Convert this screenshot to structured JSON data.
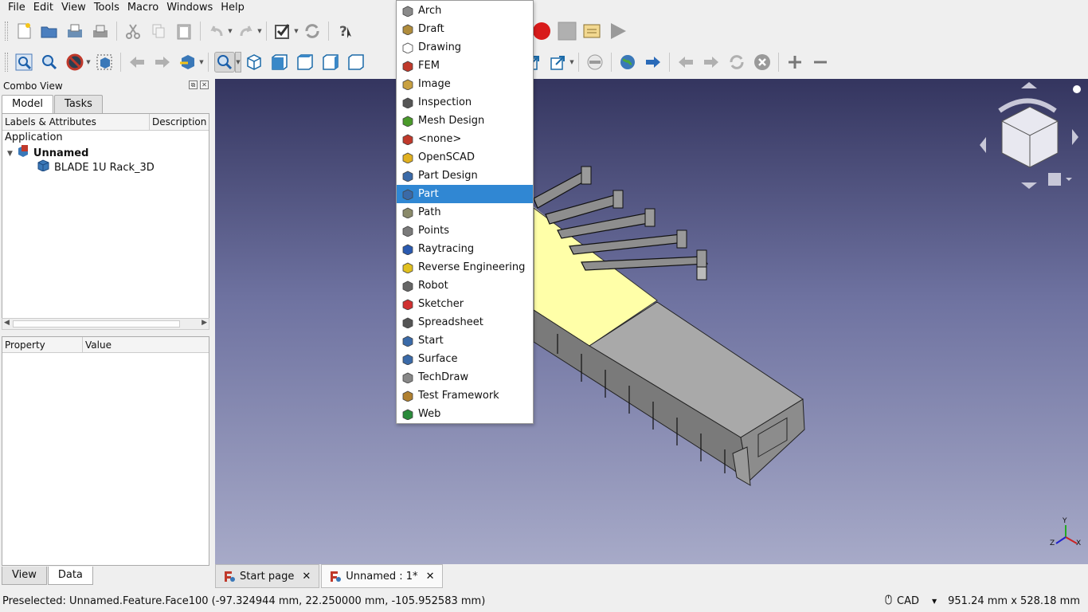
{
  "menubar": [
    "File",
    "Edit",
    "View",
    "Tools",
    "Macro",
    "Windows",
    "Help"
  ],
  "combo": {
    "title": "Combo View",
    "tabs": [
      "Model",
      "Tasks"
    ],
    "tree_headers": [
      "Labels & Attributes",
      "Description"
    ],
    "tree": {
      "root": "Application",
      "doc": "Unnamed",
      "child": "BLADE 1U Rack_3D"
    },
    "prop_headers": [
      "Property",
      "Value"
    ],
    "bottom_tabs": [
      "View",
      "Data"
    ]
  },
  "workbench_menu": {
    "selected": "Part",
    "items": [
      {
        "label": "Arch",
        "icon": "arch-icon",
        "color": "#8a8a8a"
      },
      {
        "label": "Draft",
        "icon": "draft-icon",
        "color": "#b08c3c"
      },
      {
        "label": "Drawing",
        "icon": "drawing-icon",
        "color": "#ffffff"
      },
      {
        "label": "FEM",
        "icon": "fem-icon",
        "color": "#c0392b"
      },
      {
        "label": "Image",
        "icon": "image-icon",
        "color": "#c8a040"
      },
      {
        "label": "Inspection",
        "icon": "inspection-icon",
        "color": "#555555"
      },
      {
        "label": "Mesh Design",
        "icon": "mesh-design-icon",
        "color": "#4a9a2a"
      },
      {
        "label": "<none>",
        "icon": "freecad-icon",
        "color": "#c0392b"
      },
      {
        "label": "OpenSCAD",
        "icon": "openscad-icon",
        "color": "#e0b020"
      },
      {
        "label": "Part Design",
        "icon": "part-design-icon",
        "color": "#3a6aa8"
      },
      {
        "label": "Part",
        "icon": "part-icon",
        "color": "#3a6aa8"
      },
      {
        "label": "Path",
        "icon": "path-icon",
        "color": "#8a8a6a"
      },
      {
        "label": "Points",
        "icon": "points-icon",
        "color": "#7a7a7a"
      },
      {
        "label": "Raytracing",
        "icon": "raytracing-icon",
        "color": "#2a5ab0"
      },
      {
        "label": "Reverse Engineering",
        "icon": "reverse-engineering-icon",
        "color": "#e0c020"
      },
      {
        "label": "Robot",
        "icon": "robot-icon",
        "color": "#666666"
      },
      {
        "label": "Sketcher",
        "icon": "sketcher-icon",
        "color": "#d03030"
      },
      {
        "label": "Spreadsheet",
        "icon": "spreadsheet-icon",
        "color": "#555555"
      },
      {
        "label": "Start",
        "icon": "start-icon",
        "color": "#3a6aa8"
      },
      {
        "label": "Surface",
        "icon": "surface-icon",
        "color": "#3a6aa8"
      },
      {
        "label": "TechDraw",
        "icon": "techdraw-icon",
        "color": "#888888"
      },
      {
        "label": "Test Framework",
        "icon": "test-framework-icon",
        "color": "#b08030"
      },
      {
        "label": "Web",
        "icon": "web-icon",
        "color": "#2a8a3a"
      }
    ]
  },
  "doc_tabs": [
    {
      "label": "Start page"
    },
    {
      "label": "Unnamed : 1*"
    }
  ],
  "axis_labels": {
    "y": "Y",
    "z": "Z",
    "x": "X"
  },
  "status": {
    "preselected": "Preselected: Unnamed.Feature.Face100 (-97.324944 mm, 22.250000 mm, -105.952583 mm)",
    "nav_style": "CAD",
    "dimensions": "951.24 mm x 528.18 mm"
  },
  "colors": {
    "selection": "#3087d3",
    "viewport_top": "#34355f",
    "viewport_bottom": "#a7aac8",
    "record_red": "#d81b1b"
  }
}
